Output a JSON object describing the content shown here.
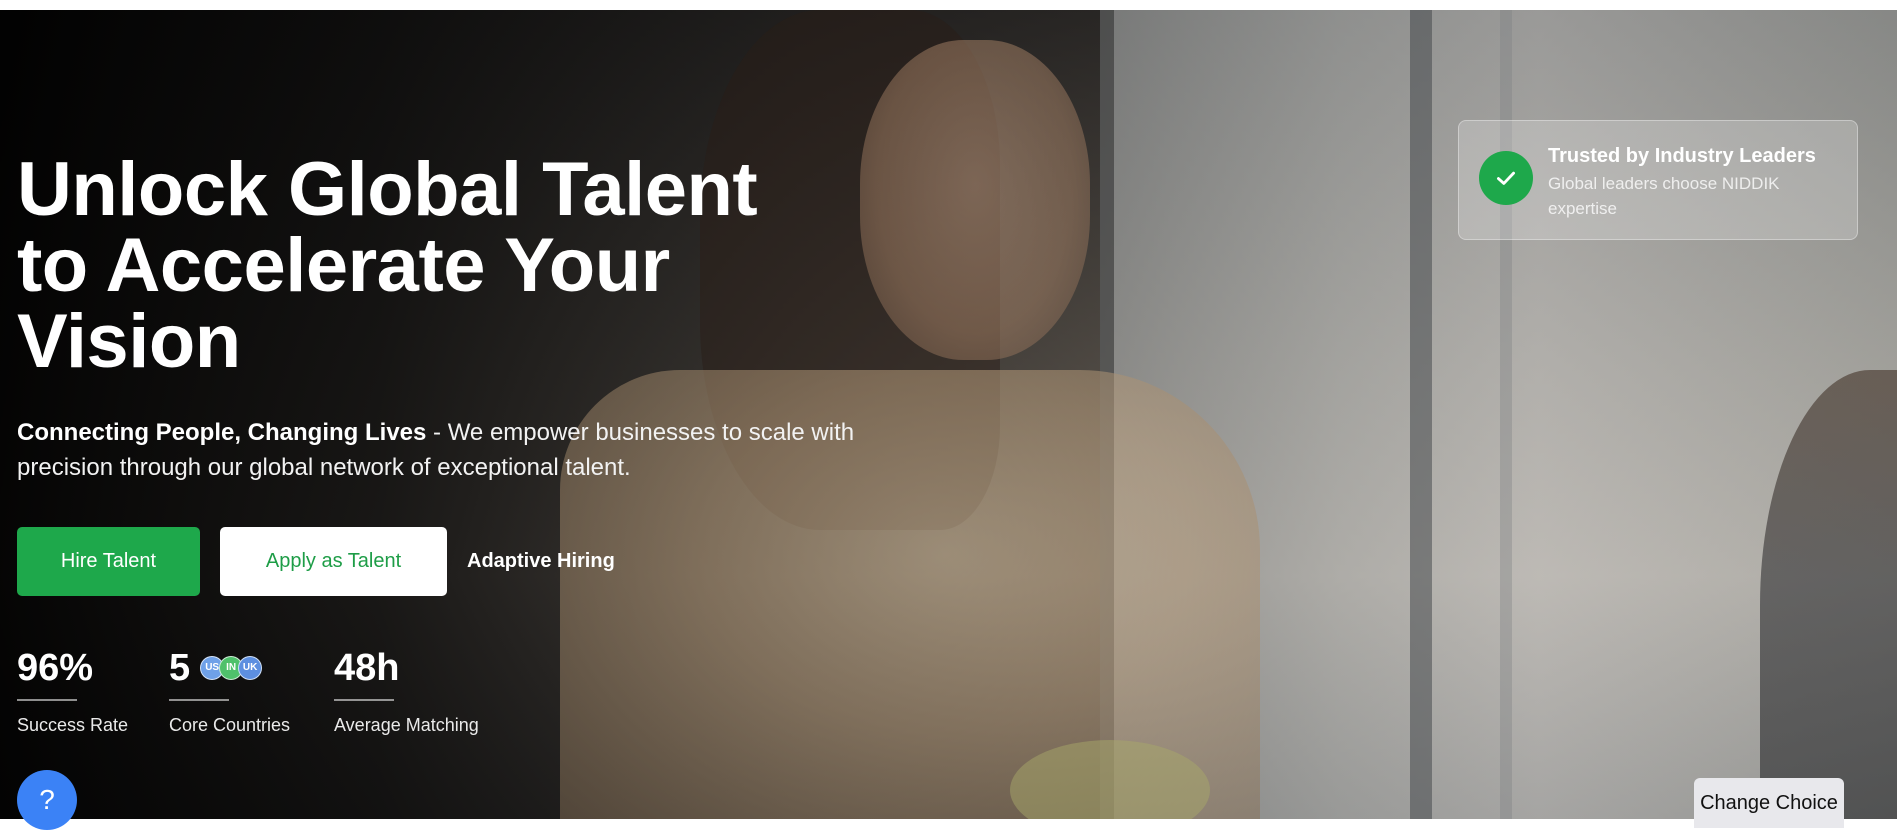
{
  "hero": {
    "title_lines": [
      "Unlock Global Talent",
      "to Accelerate Your",
      "Vision"
    ],
    "subtitle_strong": "Connecting People, Changing Lives",
    "subtitle_rest": " - We empower businesses to scale with precision through our global network of exceptional talent."
  },
  "buttons": {
    "hire": "Hire Talent",
    "apply": "Apply as Talent",
    "adaptive": "Adaptive Hiring"
  },
  "stats": [
    {
      "value": "96%",
      "label": "Success Rate"
    },
    {
      "value": "5",
      "label": "Core Countries",
      "flags": [
        "US",
        "IN",
        "UK"
      ]
    },
    {
      "value": "48h",
      "label": "Average Matching"
    }
  ],
  "trust_card": {
    "title": "Trusted by Industry Leaders",
    "description": "Global leaders choose NIDDIK expertise",
    "icon": "check-icon"
  },
  "help": {
    "label": "?"
  },
  "change_choice": {
    "label": "Change Choice"
  },
  "colors": {
    "accent_green": "#1ea84b",
    "help_blue": "#3b82f6",
    "flag_us": "#6fa1e8",
    "flag_in": "#4fc16b",
    "flag_uk": "#5d8fe0"
  }
}
